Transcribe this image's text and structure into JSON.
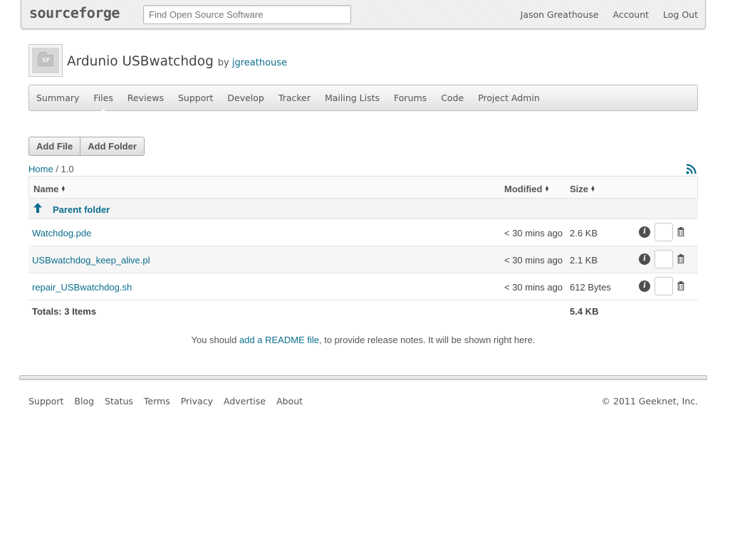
{
  "header": {
    "logo": "sourceforge",
    "search_placeholder": "Find Open Source Software",
    "user_links": [
      "Jason Greathouse",
      "Account",
      "Log Out"
    ]
  },
  "project": {
    "icon_label": "SF",
    "title": "Ardunio USBwatchdog",
    "by": "by",
    "author": "jgreathouse"
  },
  "tabs": [
    "Summary",
    "Files",
    "Reviews",
    "Support",
    "Develop",
    "Tracker",
    "Mailing Lists",
    "Forums",
    "Code",
    "Project Admin"
  ],
  "active_tab": "Files",
  "actions": {
    "add_file": "Add File",
    "add_folder": "Add Folder"
  },
  "breadcrumb": {
    "home": "Home",
    "separator": "/",
    "current": "1.0"
  },
  "table": {
    "columns": [
      "Name",
      "Modified",
      "Size"
    ],
    "parent_folder": "Parent folder",
    "rows": [
      {
        "name": "Watchdog.pde",
        "modified": "< 30 mins ago",
        "size": "2.6 KB"
      },
      {
        "name": "USBwatchdog_keep_alive.pl",
        "modified": "< 30 mins ago",
        "size": "2.1 KB"
      },
      {
        "name": "repair_USBwatchdog.sh",
        "modified": "< 30 mins ago",
        "size": "612 Bytes"
      }
    ],
    "totals_label": "Totals: 3 Items",
    "totals_size": "5.4 KB"
  },
  "readme": {
    "before": "You should ",
    "link": "add a README file",
    "after": ", to provide release notes. It will be shown right here."
  },
  "footer": {
    "links": [
      "Support",
      "Blog",
      "Status",
      "Terms",
      "Privacy",
      "Advertise",
      "About"
    ],
    "copyright": "© 2011 Geeknet, Inc."
  },
  "colors": {
    "link": "#0b6e8e",
    "text": "#555555",
    "info_icon": "#4f4f4f"
  }
}
